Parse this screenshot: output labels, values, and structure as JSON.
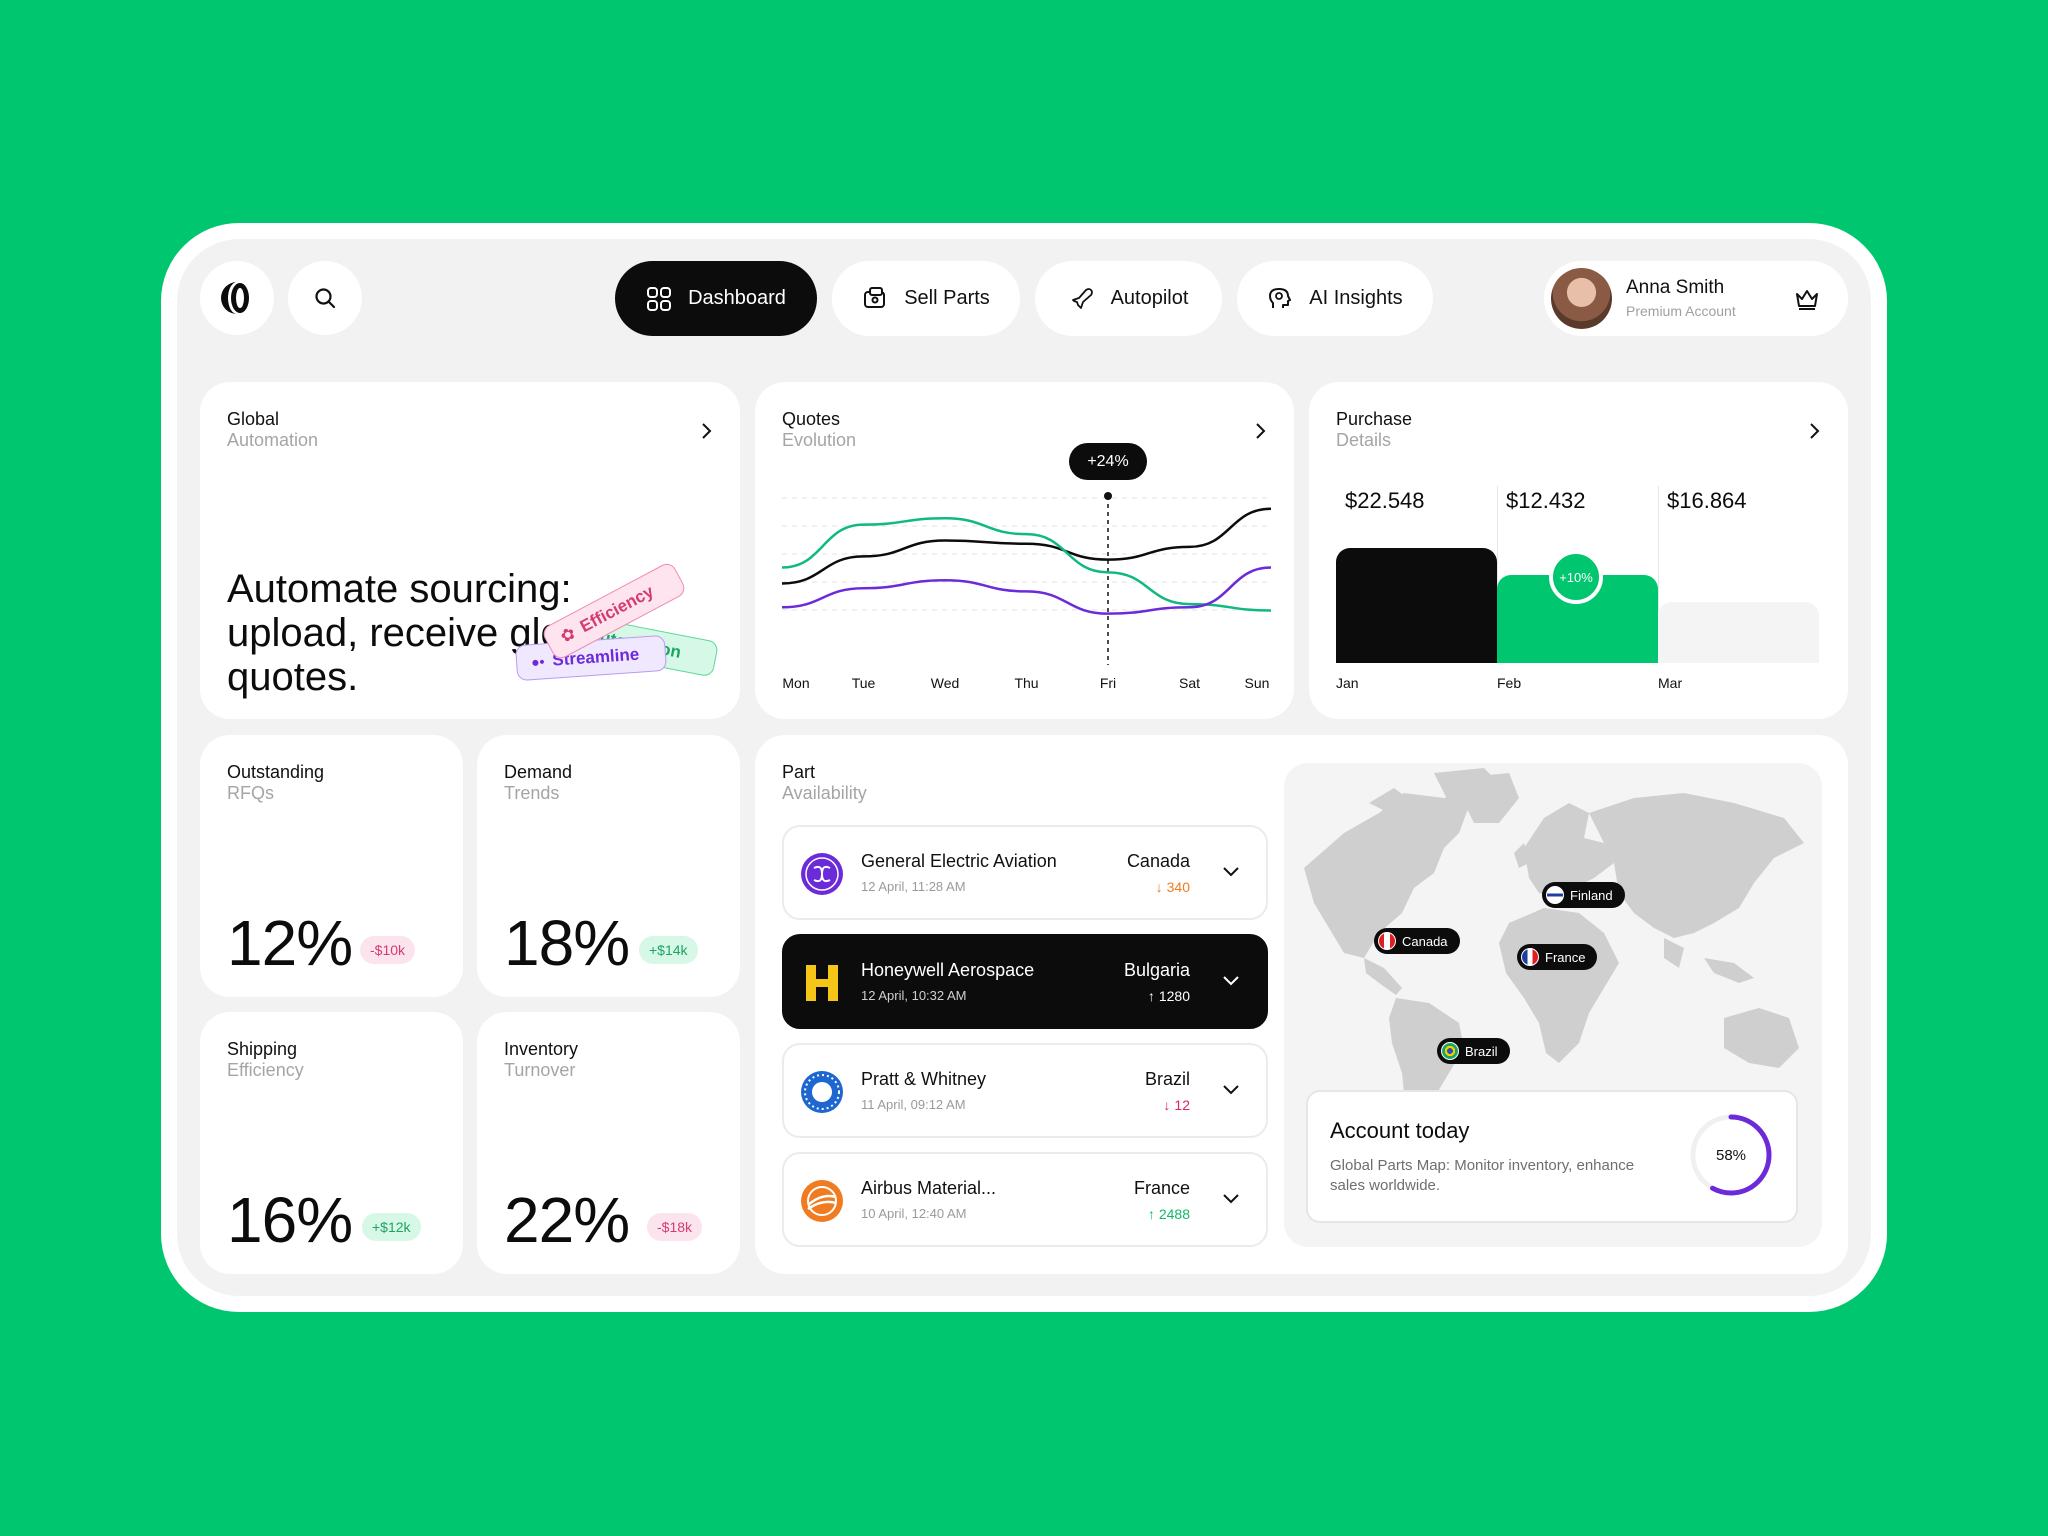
{
  "nav": {
    "items": [
      {
        "label": "Dashboard",
        "icon": "grid-icon",
        "active": true
      },
      {
        "label": "Sell Parts",
        "icon": "wallet-icon",
        "active": false
      },
      {
        "label": "Autopilot",
        "icon": "plane-icon",
        "active": false
      },
      {
        "label": "AI Insights",
        "icon": "ai-head-icon",
        "active": false
      }
    ]
  },
  "user": {
    "name": "Anna Smith",
    "subtitle": "Premium Account"
  },
  "global_automation": {
    "title": "Global",
    "subtitle": "Automation",
    "headline": "Automate sourcing: upload, receive global quotes.",
    "tags": [
      "Efficiency",
      "Automation",
      "Streamline"
    ]
  },
  "quotes": {
    "title": "Quotes",
    "subtitle": "Evolution",
    "marker": "+24%",
    "chart_data": {
      "type": "line",
      "categories": [
        "Mon",
        "Tue",
        "Wed",
        "Thu",
        "Fri",
        "Sat",
        "Sun"
      ],
      "series": [
        {
          "color": "#0C0C0C",
          "values": [
            45,
            62,
            72,
            70,
            60,
            68,
            92
          ]
        },
        {
          "color": "#10B981",
          "values": [
            55,
            82,
            86,
            76,
            52,
            32,
            28
          ]
        },
        {
          "color": "#6C2BD9",
          "values": [
            30,
            42,
            47,
            40,
            26,
            30,
            55
          ]
        }
      ],
      "ylim": [
        0,
        100
      ],
      "grid": true,
      "highlight_category": "Fri"
    }
  },
  "purchase": {
    "title": "Purchase",
    "subtitle": "Details",
    "badge": "+10%",
    "chart_data": {
      "type": "bar",
      "categories": [
        "Jan",
        "Feb",
        "Mar"
      ],
      "values": [
        22548,
        12432,
        16864
      ],
      "value_labels": [
        "$22.548",
        "$12.432",
        "$16.864"
      ],
      "bar_level": [
        0.72,
        0.55,
        0.38
      ],
      "colors": [
        "#0C0C0C",
        "#00C66F",
        "#F4F4F4"
      ]
    }
  },
  "stats": [
    {
      "title": "Outstanding",
      "subtitle": "RFQs",
      "value": "12%",
      "badge": "-$10k",
      "trend": "neg"
    },
    {
      "title": "Demand",
      "subtitle": "Trends",
      "value": "18%",
      "badge": "+$14k",
      "trend": "pos"
    },
    {
      "title": "Shipping",
      "subtitle": "Efficiency",
      "value": "16%",
      "badge": "+$12k",
      "trend": "pos"
    },
    {
      "title": "Inventory",
      "subtitle": "Turnover",
      "value": "22%",
      "badge": "-$18k",
      "trend": "neg"
    }
  ],
  "parts": {
    "title": "Part",
    "subtitle": "Availability",
    "rows": [
      {
        "name": "General Electric Aviation",
        "date": "12 April, 11:28 AM",
        "country": "Canada",
        "delta": "340",
        "direction": "down",
        "delta_color": "#F07B20"
      },
      {
        "name": "Honeywell Aerospace",
        "date": "12 April, 10:32 AM",
        "country": "Bulgaria",
        "delta": "1280",
        "direction": "up",
        "delta_color": "#FFFFFF"
      },
      {
        "name": "Pratt & Whitney",
        "date": "11 April, 09:12 AM",
        "country": "Brazil",
        "delta": "12",
        "direction": "down",
        "delta_color": "#E0245E"
      },
      {
        "name": "Airbus Material...",
        "date": "10 April, 12:40 AM",
        "country": "France",
        "delta": "2488",
        "direction": "up",
        "delta_color": "#12B76A"
      }
    ]
  },
  "map": {
    "pins": [
      "Finland",
      "Canada",
      "France",
      "Brazil"
    ],
    "account": {
      "title": "Account today",
      "description": "Global Parts Map: Monitor inventory, enhance sales worldwide.",
      "progress_label": "58%",
      "progress": 0.58
    }
  }
}
